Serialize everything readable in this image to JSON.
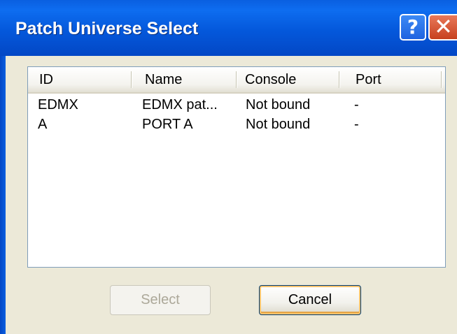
{
  "window": {
    "title": "Patch Universe Select",
    "help_glyph": "?",
    "close_glyph": "✕"
  },
  "list": {
    "columns": [
      "ID",
      "Name",
      "Console",
      "Port"
    ],
    "rows": [
      [
        "EDMX",
        "EDMX pat...",
        "Not bound",
        "-"
      ],
      [
        "A",
        "PORT A",
        "Not bound",
        "-"
      ]
    ]
  },
  "buttons": {
    "select_label": "Select",
    "cancel_label": "Cancel"
  },
  "colors": {
    "titlebar": "#0458db",
    "close_button": "#c7401e",
    "dialog_bg": "#ece9d8"
  }
}
